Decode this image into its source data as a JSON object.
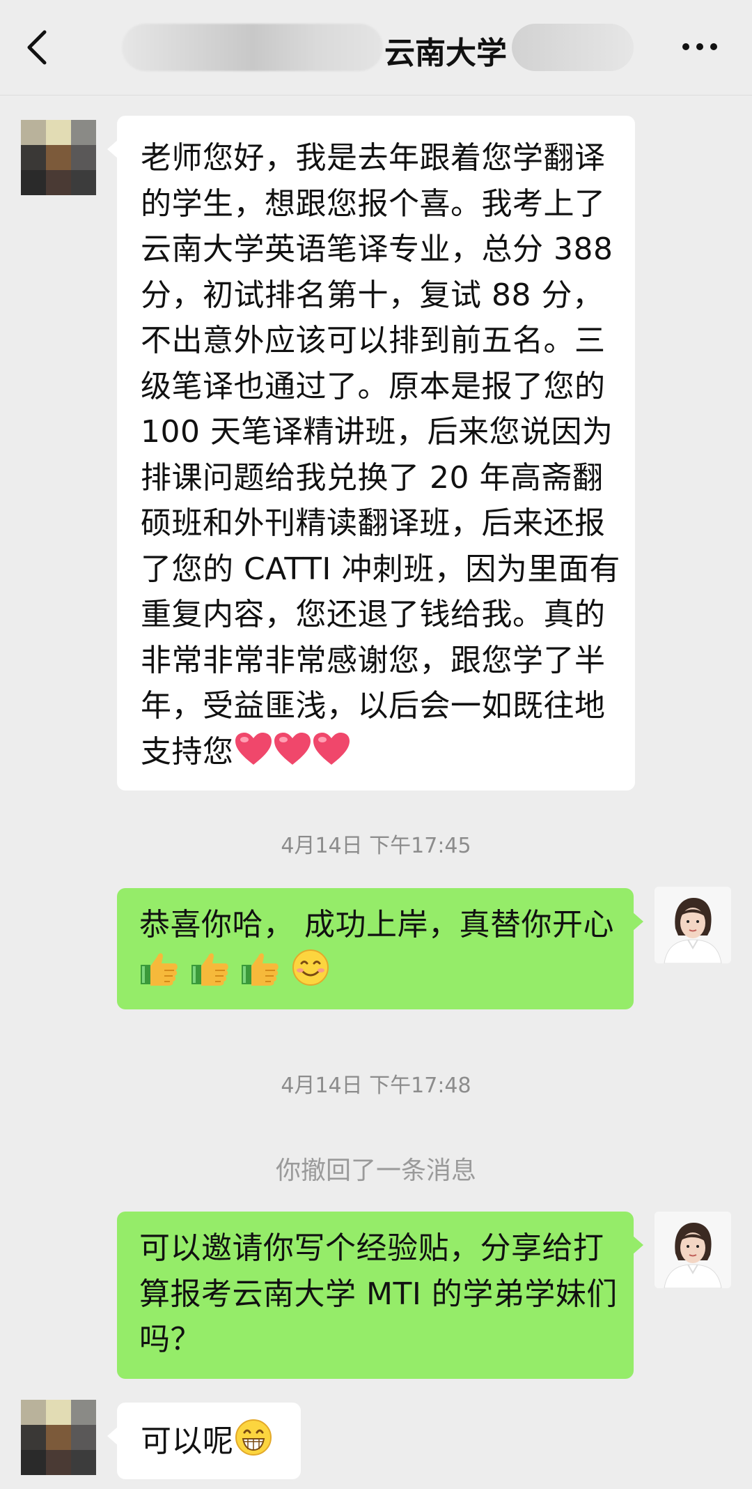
{
  "header": {
    "title": "云南大学",
    "back_icon": "chevron-left-icon",
    "more_icon": "more-dots-icon"
  },
  "messages": [
    {
      "direction": "incoming",
      "text_lines": [
        "老师您好，我是去年跟着您学翻译",
        "的学生，想跟您报个喜。我考上了",
        "云南大学英语笔译专业，总分 388",
        "分，初试排名第十，复试 88 分，",
        "不出意外应该可以排到前五名。三",
        "级笔译也通过了。原本是报了您的",
        "100 天笔译精讲班，后来您说因为",
        "排课问题给我兑换了 20 年高斋翻",
        "硕班和外刊精读翻译班，后来还报",
        "了您的 CATTI 冲刺班，因为里面有",
        "重复内容，您还退了钱给我。真的",
        "非常非常非常感谢您，跟您学了半",
        "年，受益匪浅，以后会一如既往地",
        "支持您"
      ],
      "emojis": [
        "heart-emoji",
        "heart-emoji",
        "heart-emoji"
      ]
    },
    {
      "type": "timestamp",
      "text": "4月14日 下午17:45"
    },
    {
      "direction": "outgoing",
      "text_lines": [
        "恭喜你哈， 成功上岸，真替你开心"
      ],
      "emojis": [
        "thumbs-up-emoji",
        "thumbs-up-emoji",
        "thumbs-up-emoji",
        "smile-emoji"
      ]
    },
    {
      "type": "timestamp",
      "text": "4月14日 下午17:48"
    },
    {
      "type": "system",
      "text": "你撤回了一条消息"
    },
    {
      "direction": "outgoing",
      "text_lines": [
        "可以邀请你写个经验贴，分享给打",
        "算报考云南大学 MTI 的学弟学妹们",
        "吗？"
      ]
    },
    {
      "direction": "incoming",
      "text_lines": [
        "可以呢"
      ],
      "emojis": [
        "grin-emoji"
      ]
    }
  ],
  "colors": {
    "background": "#ededed",
    "incoming_bubble": "#ffffff",
    "outgoing_bubble": "#95ec69",
    "timestamp_text": "#8c8c8c"
  }
}
